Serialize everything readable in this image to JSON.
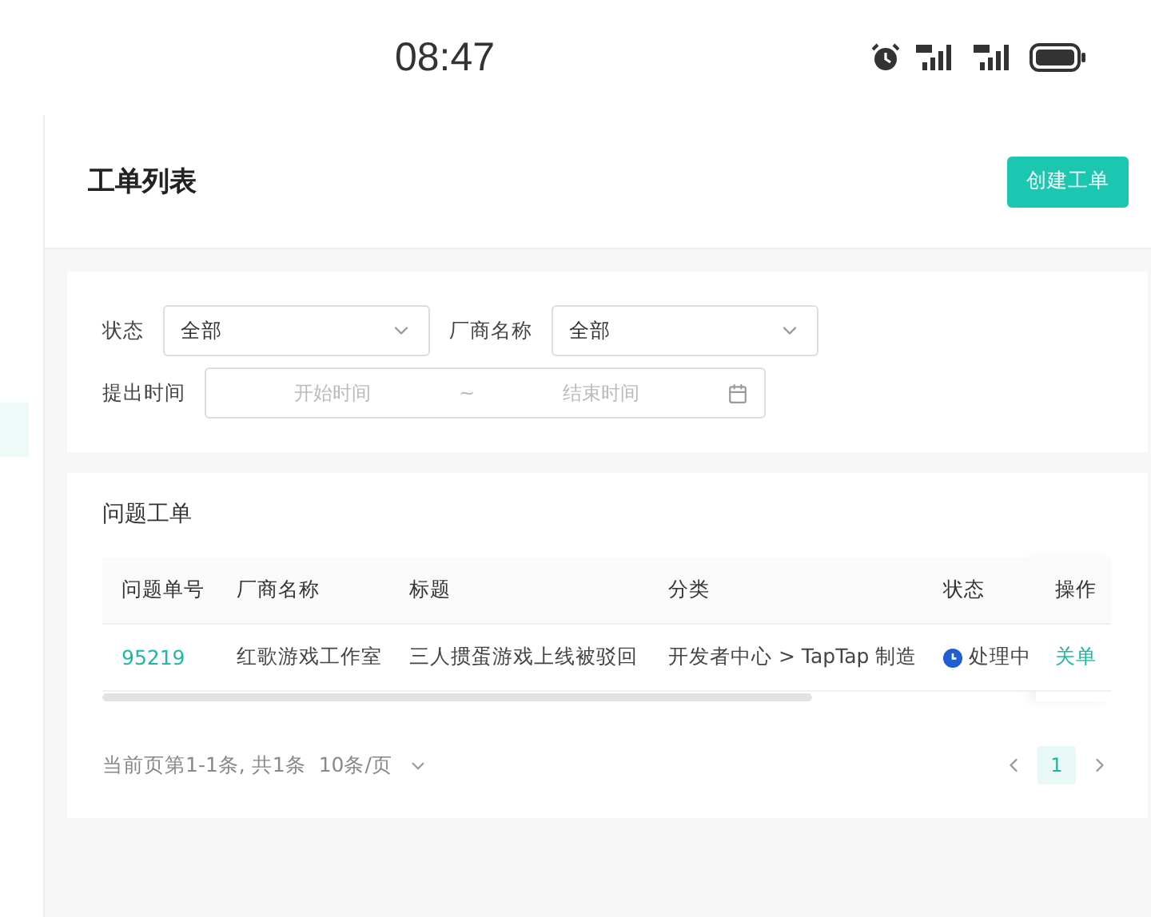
{
  "status_bar": {
    "time": "08:47"
  },
  "header": {
    "title": "工单列表",
    "create_button": "创建工单"
  },
  "filters": {
    "status": {
      "label": "状态",
      "value": "全部"
    },
    "vendor": {
      "label": "厂商名称",
      "value": "全部"
    },
    "date": {
      "label": "提出时间",
      "start_placeholder": "开始时间",
      "separator": "~",
      "end_placeholder": "结束时间"
    }
  },
  "ticket_table": {
    "title": "问题工单",
    "columns": [
      "问题单号",
      "厂商名称",
      "标题",
      "分类",
      "状态"
    ],
    "action_column": "操作",
    "rows": [
      {
        "id": "95219",
        "vendor": "红歌游戏工作室",
        "title": "三人掼蛋游戏上线被驳回",
        "category": "开发者中心 > TapTap 制造",
        "status": {
          "label": "处理中",
          "color": "#1f5fd1"
        },
        "action": "关单"
      }
    ]
  },
  "pagination": {
    "summary": "当前页第1-1条, 共1条",
    "page_size": "10条/页",
    "pages": [
      {
        "label": "1",
        "selected": true
      }
    ]
  }
}
